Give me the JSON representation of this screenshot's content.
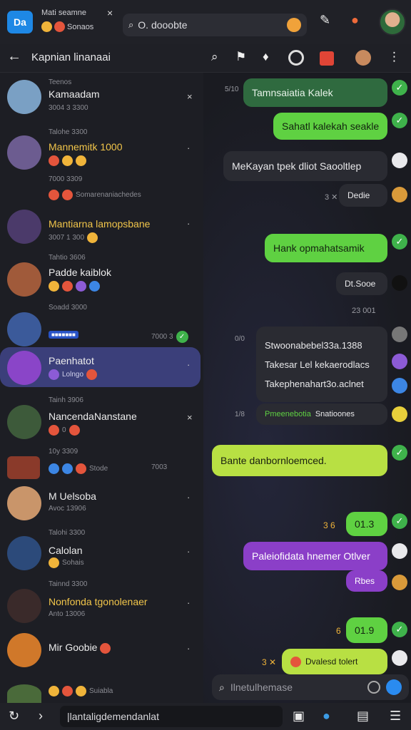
{
  "topbar": {
    "logo": "Da",
    "title": "Mati seamne",
    "subtitle": "Sonaos",
    "close": "×",
    "search_text": "O. dooobte"
  },
  "header": {
    "back": "←",
    "title": "Kapnian linanaai"
  },
  "chats": [
    {
      "small_top": "Teenos",
      "name": "Kamaadam",
      "sub": "3004 3 3300",
      "action": "×"
    },
    {
      "small_top": "Talohe 3300",
      "name": "Mannemitk 1000",
      "sub": "",
      "action": "·"
    },
    {
      "small_top": "7000 3309",
      "name": "",
      "sub": "Somarenaniachedes",
      "action": ""
    },
    {
      "small_top": "",
      "name": "Mantiarna lamopsbane",
      "sub": "3007 1 300",
      "action": "·"
    },
    {
      "small_top": "Tahtio 3606",
      "name": "Padde kaiblok",
      "sub": "",
      "action": ""
    },
    {
      "small_top": "Soadd 3000",
      "name": "",
      "sub": "7000 3",
      "action": ""
    },
    {
      "small_top": "",
      "name": "Paenhatot",
      "sub": "Lolngo",
      "action": "·"
    },
    {
      "small_top": "Tainh 3906",
      "name": "NancendaNanstane",
      "sub": "0",
      "action": "×"
    },
    {
      "small_top": "10y 3309",
      "name": "",
      "sub": "Stode",
      "action": "7003"
    },
    {
      "small_top": "",
      "name": "M Uelsoba",
      "sub": "Avoc 13906",
      "action": "·"
    },
    {
      "small_top": "Talohi 3300",
      "name": "Calolan",
      "sub": "Sohais",
      "action": "·"
    },
    {
      "small_top": "Tainnd 3300",
      "name": "Nonfonda tgonolenaer",
      "sub": "Anto 13006",
      "action": "·"
    },
    {
      "small_top": "",
      "name": "Mir Goobie",
      "sub": "",
      "action": "·"
    },
    {
      "small_top": "",
      "name": "",
      "sub": "Suiabla",
      "action": ""
    }
  ],
  "messages": [
    {
      "text": "Tamnsaiatia Kalek",
      "time": "5/10"
    },
    {
      "text": "Sahatl kalekah seakle",
      "time": ""
    },
    {
      "text": "MeKayan tpek dliot Saooltlep",
      "time": ""
    },
    {
      "text": "Dedie",
      "time": ""
    },
    {
      "text": "Hank opmahatsamik",
      "time": ""
    },
    {
      "text": "Dt.Sooe",
      "time": ""
    },
    {
      "text": "23 001",
      "time": ""
    },
    {
      "text": "Stwoonabebel33a.1388",
      "time": "0/0"
    },
    {
      "text": "Takesar Lel kekaerodlacs",
      "time": ""
    },
    {
      "text": "Takephenahart3o.aclnet",
      "time": ""
    },
    {
      "text": "Pmeenebotia",
      "time": "1/8"
    },
    {
      "text": "Snatioones",
      "time": ""
    },
    {
      "text": "Bante danbornloemced.",
      "time": ""
    },
    {
      "text": "01.3",
      "time": ""
    },
    {
      "text": "Paleiofidata hnemer Otlver",
      "time": ""
    },
    {
      "text": "Rbes",
      "time": ""
    },
    {
      "text": "01.9",
      "time": ""
    },
    {
      "text": "Dvalesd tolert",
      "time": ""
    }
  ],
  "composer": {
    "placeholder": "Ilnetulhemase"
  },
  "bottom": {
    "input_text": "|lantaligdemendanlat"
  },
  "colors": {
    "accent": "#5fd142",
    "selected": "#3b3f7a",
    "purple": "#8b3fc8",
    "bg": "#1b1c22"
  }
}
